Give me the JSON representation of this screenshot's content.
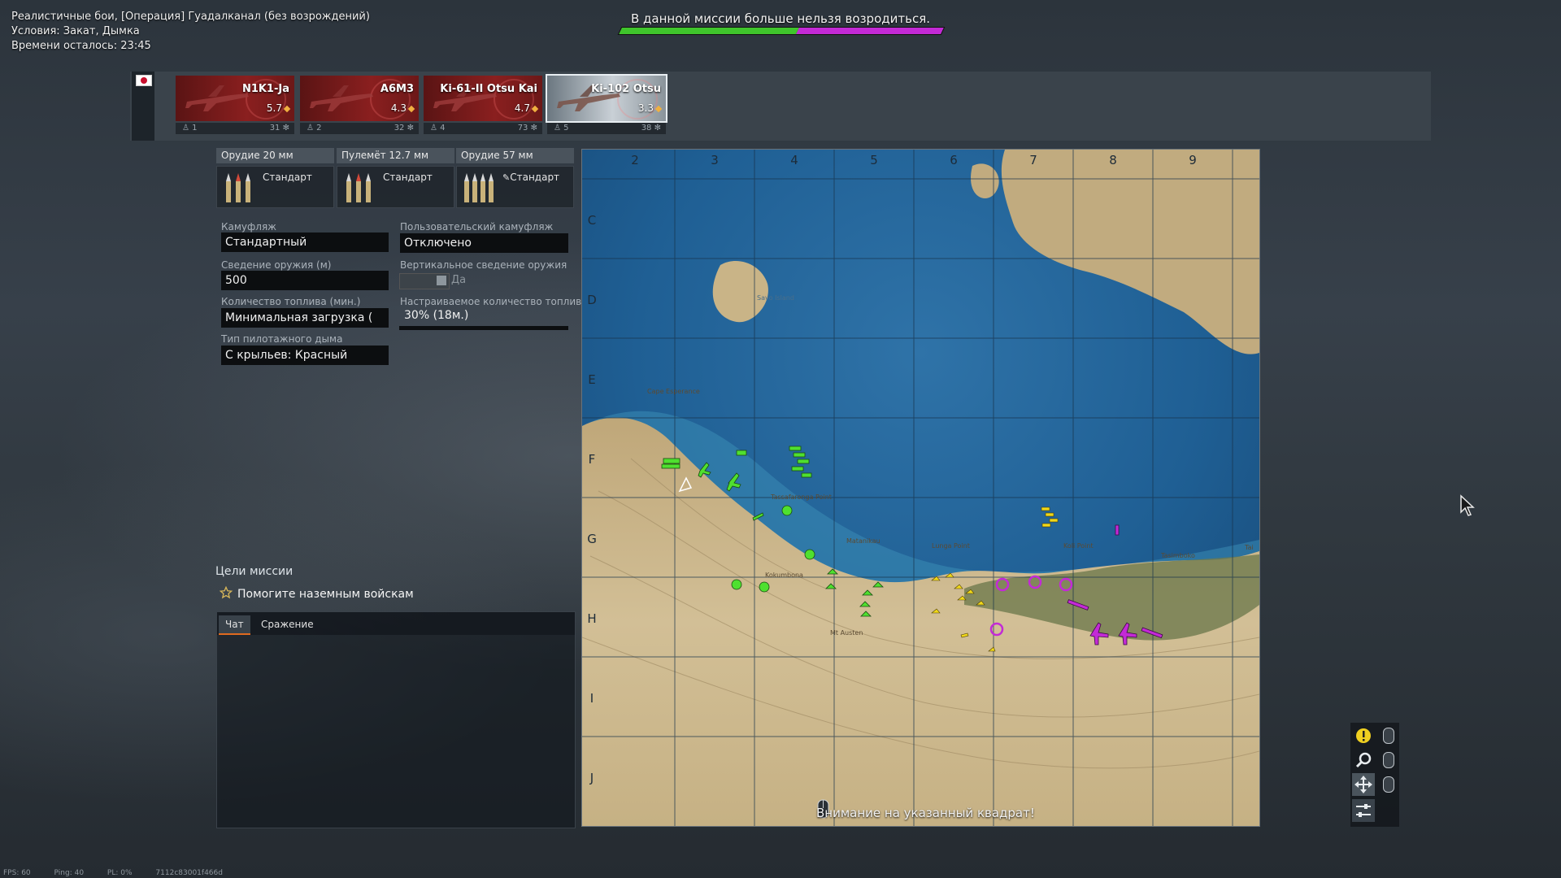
{
  "mission": {
    "title": "Реалистичные бои, [Операция] Гуадалканал (без возрождений)",
    "conditions": "Условия: Закат, Дымка",
    "time_left": "Времени осталось: 23:45"
  },
  "banner": {
    "text": "В данной миссии больше нельзя возродиться.",
    "ally_score_fraction": 0.55,
    "ally_color": "#3fc52c",
    "enemy_color": "#c32ad6"
  },
  "slotbar": {
    "country": "Japan",
    "slots": [
      {
        "name": "N1K1-Ja",
        "br": "5.7",
        "num": "1",
        "crew": "31",
        "selected": false
      },
      {
        "name": "A6M3",
        "br": "4.3",
        "num": "2",
        "crew": "32",
        "selected": false
      },
      {
        "name": "Ki-61-II Otsu Kai",
        "br": "4.7",
        "num": "4",
        "crew": "73",
        "selected": false
      },
      {
        "name": "Ki-102 Otsu",
        "br": "3.3",
        "num": "5",
        "crew": "38",
        "selected": true
      }
    ]
  },
  "weapons": [
    {
      "name": "Орудие 20 мм",
      "belt": "Стандарт"
    },
    {
      "name": "Пулемёт 12.7 мм",
      "belt": "Стандарт"
    },
    {
      "name": "Орудие 57 мм",
      "belt": "Стандарт"
    }
  ],
  "settings": {
    "camo_label": "Камуфляж",
    "camo_value": "Стандартный",
    "custom_camo_label": "Пользовательский камуфляж",
    "custom_camo_value": "Отключено",
    "convergence_label": "Сведение оружия (м)",
    "convergence_value": "500",
    "vertical_conv_label": "Вертикальное сведение оружия",
    "vertical_conv_value": "Да",
    "fuel_label": "Количество топлива (мин.)",
    "fuel_value": "Минимальная загрузка (",
    "custom_fuel_label": "Настраиваемое количество топлива",
    "custom_fuel_value": "30% (18м.)",
    "smoke_label": "Тип пилотажного дыма",
    "smoke_value": "С крыльев: Красный"
  },
  "objectives": {
    "title": "Цели миссии",
    "items": [
      "Помогите наземным войскам"
    ]
  },
  "chat": {
    "tabs": [
      "Чат",
      "Сражение"
    ]
  },
  "map": {
    "columns": [
      "2",
      "3",
      "4",
      "5",
      "6",
      "7",
      "8",
      "9"
    ],
    "rows": [
      "C",
      "D",
      "E",
      "F",
      "G",
      "H",
      "I",
      "J"
    ],
    "hint": "Внимание на указанный квадрат!",
    "place_names": [
      "Savo Island",
      "Cape Esperance",
      "Tassafaronga Point",
      "Lunga Point",
      "Koli Point",
      "Tasimboko",
      "Matanikau",
      "Mt Austen",
      "Kokumbona",
      "Tai"
    ]
  },
  "stats": {
    "fps": "FPS: 60",
    "ping": "Ping: 40",
    "pl": "PL: 0%",
    "session": "7112c83001f466d"
  }
}
